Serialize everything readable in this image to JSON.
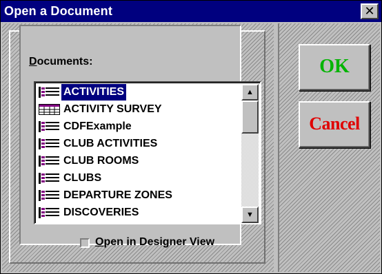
{
  "window": {
    "title": "Open a Document",
    "close_glyph": "✕"
  },
  "documents_label": {
    "mnemonic": "D",
    "rest": "ocuments:"
  },
  "list": {
    "selected_index": 0,
    "items": [
      {
        "label": "ACTIVITIES",
        "icon": "form-icon"
      },
      {
        "label": "ACTIVITY SURVEY",
        "icon": "grid-form-icon"
      },
      {
        "label": "CDFExample",
        "icon": "form-icon"
      },
      {
        "label": "CLUB ACTIVITIES",
        "icon": "form-icon"
      },
      {
        "label": "CLUB ROOMS",
        "icon": "form-icon"
      },
      {
        "label": "CLUBS",
        "icon": "form-icon"
      },
      {
        "label": "DEPARTURE ZONES",
        "icon": "form-icon"
      },
      {
        "label": "DISCOVERIES",
        "icon": "form-icon"
      }
    ]
  },
  "scrollbar": {
    "up_glyph": "▲",
    "down_glyph": "▼"
  },
  "checkbox": {
    "mnemonic": "O",
    "rest": "pen in Designer View",
    "checked": false
  },
  "buttons": {
    "ok": "OK",
    "cancel": "Cancel"
  },
  "colors": {
    "titlebar": "#00007f",
    "selection": "#00007f",
    "ok_text": "#00b400",
    "cancel_text": "#e00000",
    "icon_purple": "#800080"
  }
}
